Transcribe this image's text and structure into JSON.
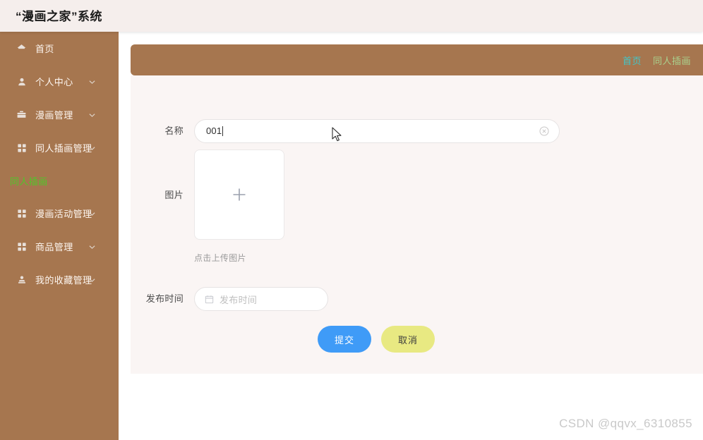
{
  "header": {
    "title": "“漫画之家”系统"
  },
  "sidebar": {
    "items": [
      {
        "label": "首页",
        "icon": "home-icon",
        "expandable": false
      },
      {
        "label": "个人中心",
        "icon": "user-icon",
        "expandable": true
      },
      {
        "label": "漫画管理",
        "icon": "briefcase-icon",
        "expandable": true
      },
      {
        "label": "同人插画管理",
        "icon": "grid-icon",
        "expandable": true
      },
      {
        "label": "漫画活动管理",
        "icon": "grid-icon",
        "expandable": true
      },
      {
        "label": "商品管理",
        "icon": "grid-icon",
        "expandable": true
      },
      {
        "label": "我的收藏管理",
        "icon": "collect-icon",
        "expandable": true
      }
    ],
    "submenu": {
      "label": "同人插画",
      "active_color": "#4fc72a"
    }
  },
  "breadcrumb": {
    "home": "首页",
    "separator": "",
    "current": "同人插画",
    "home_color": "#41c7c9",
    "current_color": "#a9d18e",
    "bar_color": "#a6764f"
  },
  "form": {
    "name_field": {
      "label": "名称",
      "value": "001",
      "clear_icon": "circle-close-icon"
    },
    "image_field": {
      "label": "图片",
      "upload_icon": "plus-icon",
      "hint": "点击上传图片"
    },
    "date_field": {
      "label": "发布时间",
      "placeholder": "发布时间",
      "value": "",
      "icon": "calendar-icon"
    },
    "buttons": {
      "submit": "提交",
      "cancel": "取消",
      "submit_color": "#3f9bf7",
      "cancel_color": "#e8e982"
    }
  },
  "watermark": {
    "text": "CSDN @qqvx_6310855"
  }
}
